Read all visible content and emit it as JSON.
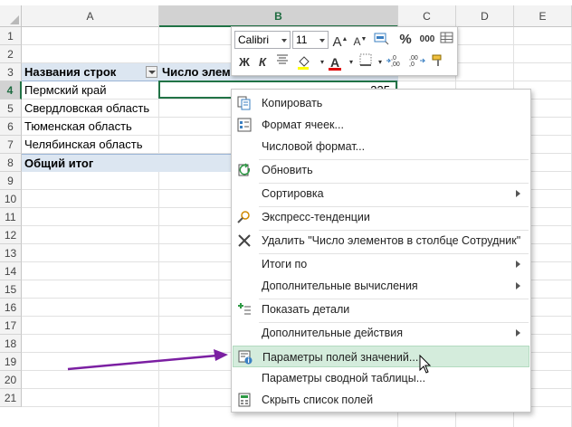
{
  "columns": [
    "A",
    "B",
    "C",
    "D",
    "E"
  ],
  "rows": [
    "1",
    "2",
    "3",
    "4",
    "5",
    "6",
    "7",
    "8",
    "9",
    "10",
    "11",
    "12",
    "13",
    "14",
    "15",
    "16",
    "17",
    "18",
    "19",
    "20",
    "21"
  ],
  "pivot": {
    "header_rows": "Названия строк",
    "header_values": "Число элем",
    "items": [
      "Пермский край",
      "Свердловская область",
      "Тюменская область",
      "Челябинская область"
    ],
    "first_value": "235",
    "total": "Общий итог"
  },
  "mini_toolbar": {
    "font": "Calibri",
    "size": "11",
    "grow": "A",
    "shrink": "A",
    "percent": "%",
    "thousands": "000",
    "bold": "Ж",
    "italic": "К",
    "font_color_letter": "A"
  },
  "context_menu": {
    "items": [
      {
        "label": "Копировать",
        "icon": "copy-icon"
      },
      {
        "label": "Формат ячеек...",
        "icon": "format-cells-icon"
      },
      {
        "label": "Числовой формат..."
      },
      {
        "label": "Обновить",
        "icon": "refresh-icon"
      },
      {
        "label": "Сортировка",
        "submenu": true
      },
      {
        "label": "Экспресс-тенденции",
        "icon": "quick-explore-icon"
      },
      {
        "label": "Удалить \"Число элементов в столбце Сотрудник\"",
        "icon": "delete-x-icon"
      },
      {
        "label": "Итоги по",
        "submenu": true
      },
      {
        "label": "Дополнительные вычисления",
        "submenu": true
      },
      {
        "label": "Показать детали",
        "icon": "show-details-icon"
      },
      {
        "label": "Дополнительные действия",
        "submenu": true
      },
      {
        "label": "Параметры полей значений...",
        "icon": "field-settings-icon",
        "highlighted": true
      },
      {
        "label": "Параметры сводной таблицы..."
      },
      {
        "label": "Скрыть список полей",
        "icon": "field-list-icon"
      }
    ]
  },
  "colors": {
    "excel_green": "#217346",
    "pivot_fill": "#dce6f1",
    "menu_highlight": "#d4ecdc",
    "arrow": "#7b1fa2",
    "font_color_bar": "#e00000"
  }
}
